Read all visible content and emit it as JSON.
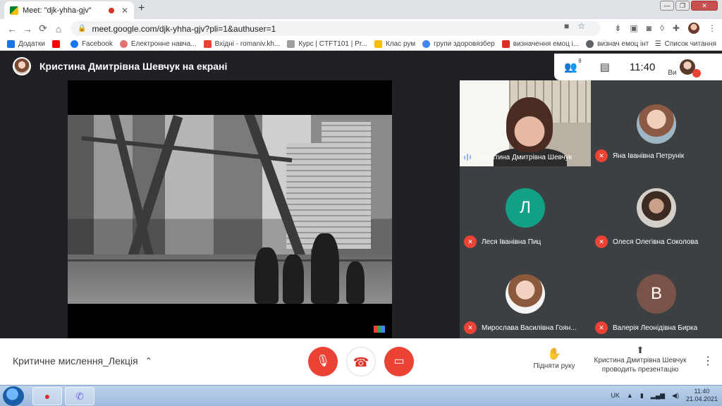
{
  "browser": {
    "tab_title": "Meet: \"djk-yhha-gjv\"",
    "tab_close": "✕",
    "new_tab": "+",
    "url": "meet.google.com/djk-yhha-gjv?pli=1&authuser=1",
    "window_controls": [
      "—",
      "❐",
      "✕"
    ]
  },
  "bookmarks": [
    {
      "label": "Додатки",
      "color": "#1a73e8"
    },
    {
      "label": "",
      "color": "#ff0000"
    },
    {
      "label": "Facebook",
      "color": "#1877f2"
    },
    {
      "label": "Електронне навча...",
      "color": "#e57373"
    },
    {
      "label": "Вхідні - romaniv.kh...",
      "color": "#ea4335"
    },
    {
      "label": "Курс | CTFT101 | Pr...",
      "color": "#9e9e9e"
    },
    {
      "label": "Клас рум",
      "color": "#fbbc04"
    },
    {
      "label": "групи здоровязбер",
      "color": "#4285f4"
    },
    {
      "label": "визначення емоц і...",
      "color": "#d93025"
    },
    {
      "label": "визнач емоц інт",
      "color": "#5f6368"
    }
  ],
  "reading_list": "Список читання",
  "meet": {
    "presenter_title": "Кристина Дмитрівна Шевчук на екрані",
    "people_count": "8",
    "clock": "11:40",
    "you_label": "Ви"
  },
  "participants": [
    {
      "name": "Кристина Дмитрівна Шевчук",
      "muted": false
    },
    {
      "name": "Яна Іванівна Петрунік",
      "muted": true
    },
    {
      "name": "Леся Іванівна Пиц",
      "muted": true,
      "letter": "Л",
      "color": "#12a087"
    },
    {
      "name": "Олеся Олегівна Соколова",
      "muted": true
    },
    {
      "name": "Мирослава Василівна Гоян...",
      "muted": true
    },
    {
      "name": "Валерія Леонідівна Бирка",
      "muted": true,
      "letter": "В",
      "color": "#7a5348"
    }
  ],
  "bottom": {
    "meeting_title": "Критичне мислення_Лекція",
    "raise_hand": "Підняти руку",
    "presenting": "Кристина Дмитрівна Шевчук проводить презентацію"
  },
  "taskbar": {
    "lang": "UK",
    "time": "11:40",
    "date": "21.04.2021"
  }
}
